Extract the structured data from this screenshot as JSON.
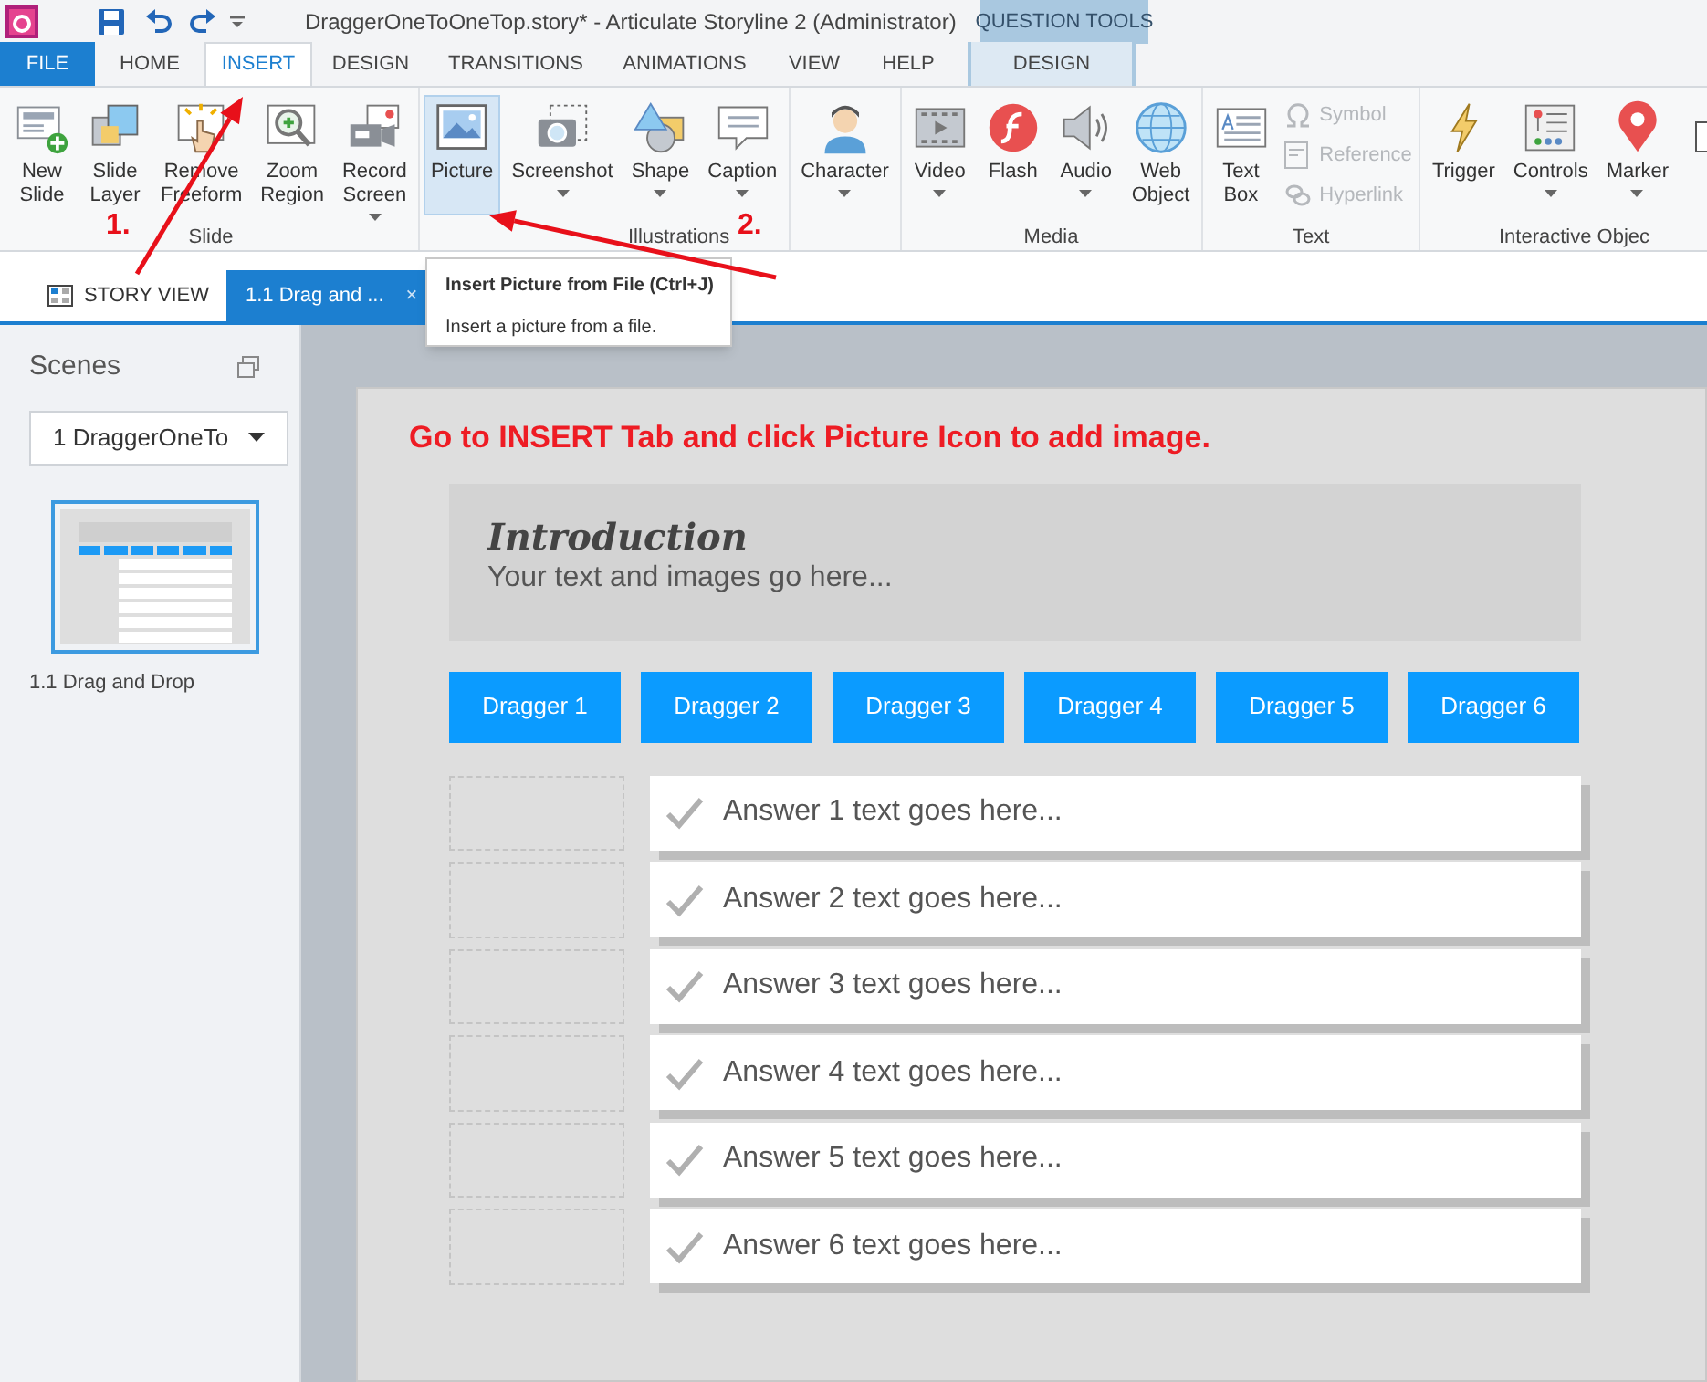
{
  "app": {
    "title": "DraggerOneToOneTop.story* -  Articulate Storyline 2 (Administrator)",
    "contextual_label": "QUESTION TOOLS"
  },
  "menu_tabs": [
    {
      "label": "FILE",
      "kind": "file",
      "selected": false
    },
    {
      "label": "HOME",
      "kind": "normal",
      "selected": false
    },
    {
      "label": "INSERT",
      "kind": "normal",
      "selected": true
    },
    {
      "label": "DESIGN",
      "kind": "normal",
      "selected": false
    },
    {
      "label": "TRANSITIONS",
      "kind": "normal",
      "selected": false
    },
    {
      "label": "ANIMATIONS",
      "kind": "normal",
      "selected": false
    },
    {
      "label": "VIEW",
      "kind": "normal",
      "selected": false
    },
    {
      "label": "HELP",
      "kind": "normal",
      "selected": false
    },
    {
      "label": "DESIGN",
      "kind": "contextual",
      "selected": false
    }
  ],
  "ribbon": {
    "groups": [
      {
        "label": "Slide",
        "buttons": [
          {
            "label": "New Slide",
            "selected": false,
            "dropdown": false
          },
          {
            "label": "Slide Layer",
            "selected": false,
            "dropdown": false
          },
          {
            "label": "Remove Freeform",
            "selected": false,
            "dropdown": false
          },
          {
            "label": "Zoom Region",
            "selected": false,
            "dropdown": false
          },
          {
            "label": "Record Screen",
            "selected": false,
            "dropdown": true
          }
        ]
      },
      {
        "label": "Illustrations",
        "buttons": [
          {
            "label": "Picture",
            "selected": true,
            "dropdown": false
          },
          {
            "label": "Screenshot",
            "selected": false,
            "dropdown": true
          },
          {
            "label": "Shape",
            "selected": false,
            "dropdown": true
          },
          {
            "label": "Caption",
            "selected": false,
            "dropdown": true
          }
        ]
      },
      {
        "buttons": [
          {
            "label": "Character",
            "selected": false,
            "dropdown": true
          }
        ]
      },
      {
        "label": "Media",
        "buttons": [
          {
            "label": "Video",
            "selected": false,
            "dropdown": true
          },
          {
            "label": "Flash",
            "selected": false,
            "dropdown": false
          },
          {
            "label": "Audio",
            "selected": false,
            "dropdown": true
          },
          {
            "label": "Web Object",
            "selected": false,
            "dropdown": false
          }
        ]
      },
      {
        "label": "Text",
        "buttons": [
          {
            "label": "Text Box",
            "kind": "large",
            "disabled": false
          },
          {
            "label": "Symbol",
            "kind": "small",
            "disabled": true
          },
          {
            "label": "Reference",
            "kind": "small",
            "disabled": true
          },
          {
            "label": "Hyperlink",
            "kind": "small",
            "disabled": true
          }
        ]
      },
      {
        "label": "Interactive Objec",
        "buttons": [
          {
            "label": "Trigger",
            "selected": false,
            "dropdown": false
          },
          {
            "label": "Controls",
            "selected": false,
            "dropdown": true
          },
          {
            "label": "Marker",
            "selected": false,
            "dropdown": true
          }
        ]
      }
    ]
  },
  "view_tabs": [
    {
      "label": "STORY VIEW",
      "selected": false
    },
    {
      "label": "1.1 Drag and ...",
      "selected": true,
      "close": "×"
    }
  ],
  "tooltip": {
    "title": "Insert Picture from File (Ctrl+J)",
    "description": "Insert a picture from a file."
  },
  "sidebar": {
    "title": "Scenes",
    "scene_dropdown": "1 DraggerOneTo",
    "slides": [
      {
        "label": "1.1 Drag and Drop",
        "selected": true
      }
    ]
  },
  "slide": {
    "instruction": "Go to INSERT Tab and click Picture Icon to add image.",
    "intro_title": "Introduction",
    "intro_body": "Your text and images go here...",
    "draggers": [
      "Dragger 1",
      "Dragger 2",
      "Dragger 3",
      "Dragger 4",
      "Dragger 5",
      "Dragger 6"
    ],
    "answers": [
      "Answer 1 text goes here...",
      "Answer 2 text goes here...",
      "Answer 3 text goes here...",
      "Answer 4 text goes here...",
      "Answer 5 text goes here...",
      "Answer 6 text goes here..."
    ]
  },
  "annotations": [
    {
      "label": "1."
    },
    {
      "label": "2."
    }
  ]
}
